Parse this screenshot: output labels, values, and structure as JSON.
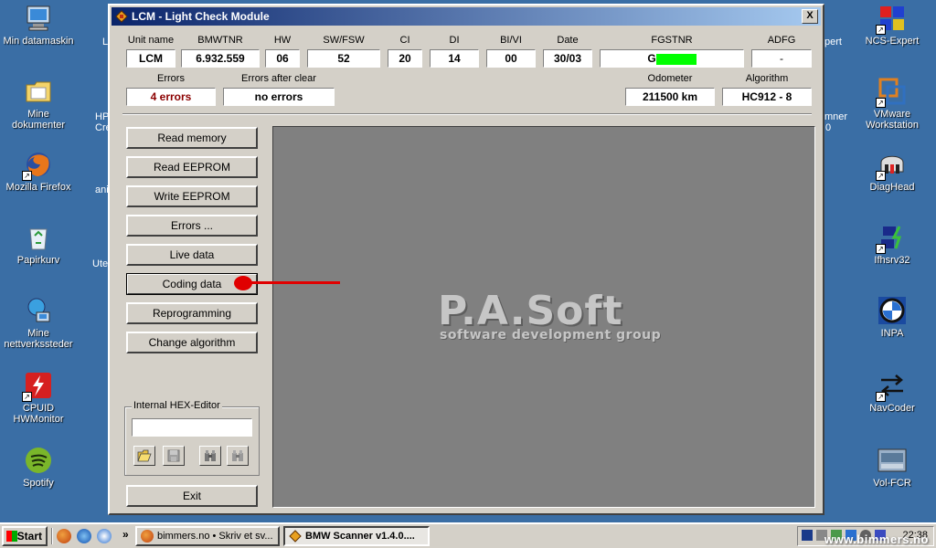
{
  "desktop": {
    "left_icons": [
      {
        "name": "my-computer",
        "label": "Min datamaskin"
      },
      {
        "name": "my-documents",
        "label": "Mine dokumenter"
      },
      {
        "name": "firefox",
        "label": "Mozilla Firefox"
      },
      {
        "name": "recycle-bin",
        "label": "Papirkurv"
      },
      {
        "name": "network-places",
        "label": "Mine nettverkssteder"
      },
      {
        "name": "cpuid",
        "label": "CPUID HWMonitor"
      },
      {
        "name": "spotify",
        "label": "Spotify"
      }
    ],
    "right_icons": [
      {
        "name": "ncs-expert",
        "label": "NCS-Expert"
      },
      {
        "name": "vmware",
        "label": "VMware Workstation"
      },
      {
        "name": "diaghead",
        "label": "DiagHead"
      },
      {
        "name": "ifhsrv32",
        "label": "Ifhsrv32"
      },
      {
        "name": "inpa",
        "label": "INPA"
      },
      {
        "name": "navcoder",
        "label": "NavCoder"
      },
      {
        "name": "vol-fcr",
        "label": "Vol-FCR"
      }
    ],
    "partial_labels": [
      "HP",
      "Cre",
      "ani",
      "Ute",
      "L",
      "pert",
      "mner",
      "0"
    ]
  },
  "window": {
    "title": "LCM - Light Check Module",
    "close_label": "X",
    "headers": {
      "unit_name": "Unit name",
      "bmwtnr": "BMWTNR",
      "hw": "HW",
      "sw_fsw": "SW/FSW",
      "ci": "CI",
      "di": "DI",
      "bi_vi": "BI/VI",
      "date": "Date",
      "fgstnr": "FGSTNR",
      "adfg": "ADFG",
      "errors": "Errors",
      "errors_after_clear": "Errors after clear",
      "odometer": "Odometer",
      "algorithm": "Algorithm"
    },
    "values": {
      "unit_name": "LCM",
      "bmwtnr": "6.932.559",
      "hw": "06",
      "sw_fsw": "52",
      "ci": "20",
      "di": "14",
      "bi_vi": "00",
      "date": "30/03",
      "fgstnr": "G",
      "adfg": "-",
      "errors": "4 errors",
      "errors_after_clear": "no errors",
      "odometer": "211500 km",
      "algorithm": "HC912 - 8"
    },
    "buttons": [
      {
        "name": "read-memory-button",
        "label": "Read memory"
      },
      {
        "name": "read-eeprom-button",
        "label": "Read EEPROM"
      },
      {
        "name": "write-eeprom-button",
        "label": "Write EEPROM"
      },
      {
        "name": "errors-button",
        "label": "Errors ..."
      },
      {
        "name": "live-data-button",
        "label": "Live data"
      },
      {
        "name": "coding-data-button",
        "label": "Coding data"
      },
      {
        "name": "reprogramming-button",
        "label": "Reprogramming"
      },
      {
        "name": "change-algorithm-button",
        "label": "Change algorithm"
      }
    ],
    "hex_editor": {
      "group_label": "Internal HEX-Editor",
      "value": "",
      "tools": [
        "open-icon",
        "save-icon",
        "find-icon",
        "find-next-icon"
      ]
    },
    "exit_label": "Exit",
    "logo": {
      "main": "P.A.Soft",
      "sub": "software development group"
    },
    "colors": {
      "error_text": "#8b0000",
      "fgstnr_highlight": "#00ff00",
      "annotation": "#e00000"
    }
  },
  "taskbar": {
    "start_label": "Start",
    "tasks": [
      {
        "label": "bimmers.no • Skriv et sv...",
        "active": false
      },
      {
        "label": "BMW Scanner v1.4.0....",
        "active": true
      }
    ],
    "clock": "22:38"
  },
  "watermark": "www.bimmers.no"
}
